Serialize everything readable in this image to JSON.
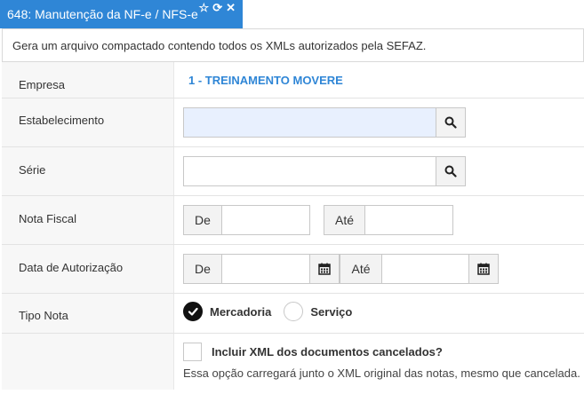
{
  "tab": {
    "title": "648: Manutenção da NF-e / NFS-e",
    "favorite_icon": "star-icon",
    "refresh_icon": "refresh-icon",
    "close_icon": "close-icon"
  },
  "description": "Gera um arquivo compactado contendo todos os XMLs autorizados pela SEFAZ.",
  "form": {
    "empresa": {
      "label": "Empresa",
      "value": "1 - TREINAMENTO MOVERE"
    },
    "estabelecimento": {
      "label": "Estabelecimento",
      "value": ""
    },
    "serie": {
      "label": "Série",
      "value": ""
    },
    "nota_fiscal": {
      "label": "Nota Fiscal",
      "de_label": "De",
      "ate_label": "Até",
      "de_value": "",
      "ate_value": ""
    },
    "data_autorizacao": {
      "label": "Data de Autorização",
      "de_label": "De",
      "ate_label": "Até",
      "de_value": "",
      "ate_value": ""
    },
    "tipo_nota": {
      "label": "Tipo Nota",
      "options": [
        {
          "label": "Mercadoria",
          "checked": true
        },
        {
          "label": "Serviço",
          "checked": false
        }
      ]
    },
    "incluir_cancelados": {
      "label": "Incluir XML dos documentos cancelados?",
      "help": "Essa opção carregará junto o XML original das notas, mesmo que cancelada.",
      "checked": false
    }
  },
  "colors": {
    "accent": "#2f86d6",
    "highlight_input": "#e8f0fe",
    "label_bg": "#f7f7f7"
  }
}
